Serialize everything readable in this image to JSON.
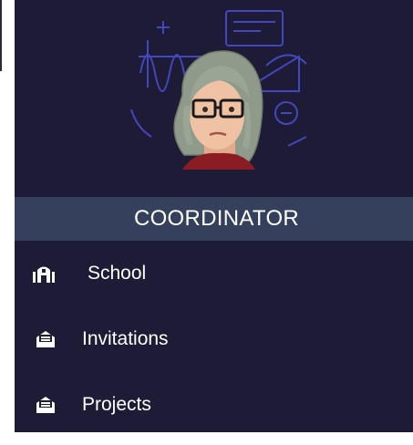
{
  "sidebar": {
    "role": "COORDINATOR",
    "items": [
      {
        "label": "School",
        "icon": "school-icon"
      },
      {
        "label": "Invitations",
        "icon": "envelope-icon"
      },
      {
        "label": "Projects",
        "icon": "envelope-icon"
      }
    ]
  },
  "colors": {
    "sidebar_bg": "#1d1b35",
    "banner_bg": "#34405c",
    "text": "#ffffff",
    "doodle": "#4a4fd8"
  }
}
